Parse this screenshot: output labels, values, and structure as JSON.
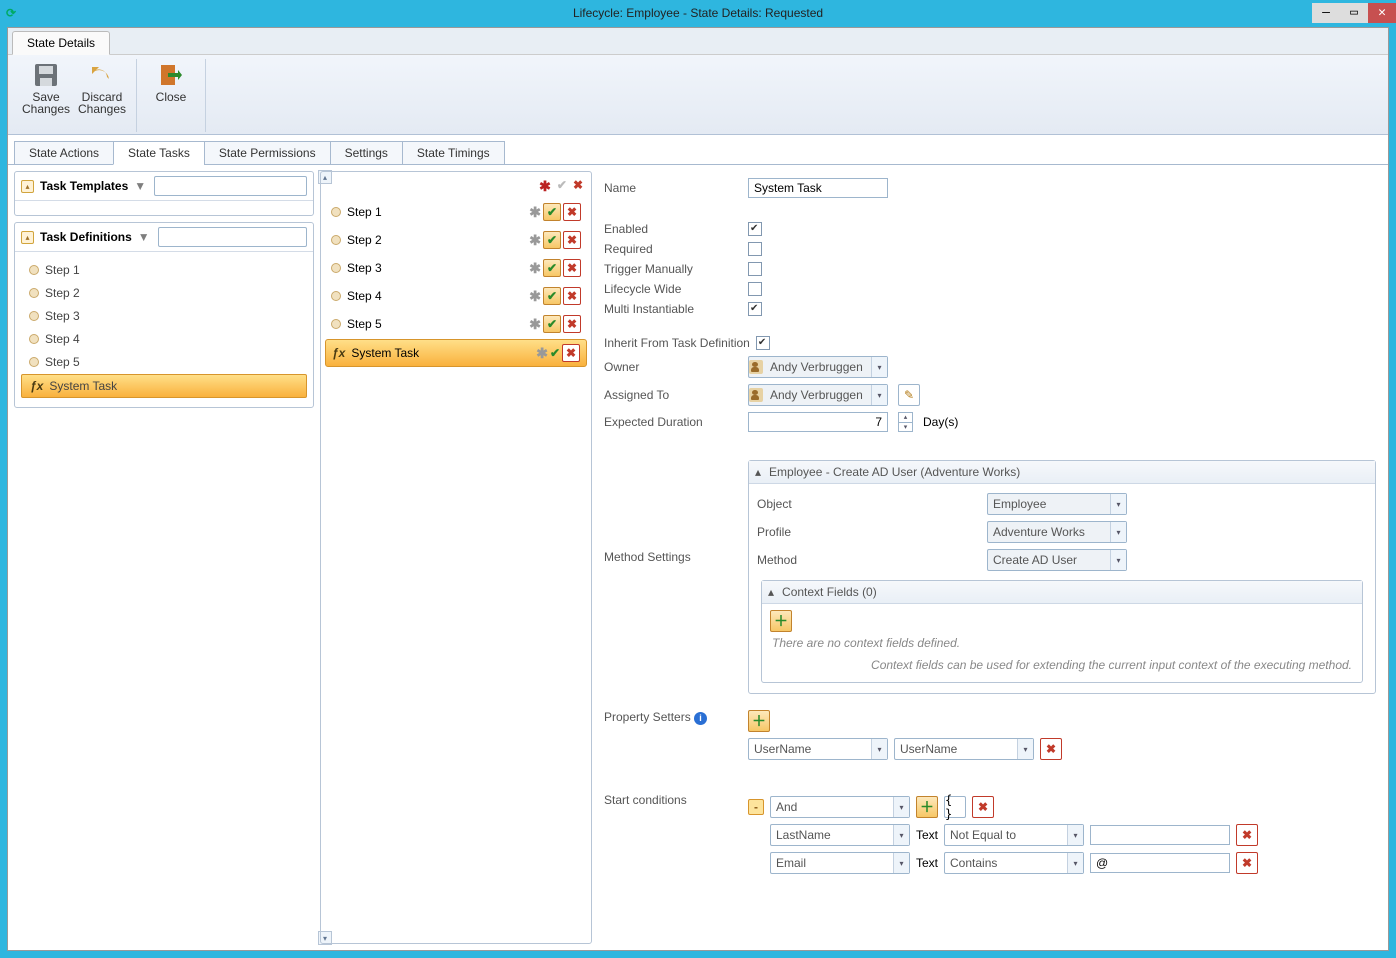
{
  "titlebar": {
    "title": "Lifecycle: Employee - State Details: Requested"
  },
  "ribbon": {
    "tab": "State Details",
    "buttons": {
      "save": "Save\nChanges",
      "discard": "Discard\nChanges",
      "close": "Close"
    }
  },
  "tabs": {
    "actions": "State Actions",
    "tasks": "State Tasks",
    "permissions": "State Permissions",
    "settings": "Settings",
    "timings": "State Timings"
  },
  "left": {
    "templates_label": "Task Templates",
    "definitions_label": "Task Definitions",
    "definitions": [
      "Step 1",
      "Step 2",
      "Step 3",
      "Step 4",
      "Step 5",
      "System Task"
    ]
  },
  "mid": {
    "items": [
      "Step 1",
      "Step 2",
      "Step 3",
      "Step 4",
      "Step 5",
      "System Task"
    ]
  },
  "form": {
    "name_label": "Name",
    "name_value": "System Task",
    "enabled_label": "Enabled",
    "required_label": "Required",
    "trigger_label": "Trigger Manually",
    "lifecycle_label": "Lifecycle Wide",
    "multi_label": "Multi Instantiable",
    "inherit_label": "Inherit From Task Definition",
    "owner_label": "Owner",
    "owner_value": "Andy Verbruggen",
    "assigned_label": "Assigned To",
    "assigned_value": "Andy Verbruggen",
    "duration_label": "Expected Duration",
    "duration_value": "7",
    "duration_unit": "Day(s)",
    "method_settings_label": "Method Settings",
    "method_group_title": "Employee   - Create AD User   (Adventure Works)",
    "object_label": "Object",
    "object_value": "Employee",
    "profile_label": "Profile",
    "profile_value": "Adventure Works",
    "method_label": "Method",
    "method_value": "Create AD User",
    "context_header": "Context Fields  (0)",
    "context_hint1": "There are no context fields defined.",
    "context_hint2": "Context fields can be used for extending the current input context of the executing method.",
    "prop_setters_label": "Property Setters",
    "prop_left": "UserName",
    "prop_right": "UserName",
    "start_label": "Start conditions",
    "start_op": "And",
    "cond1_field": "LastName",
    "cond1_type": "Text",
    "cond1_op": "Not Equal to",
    "cond1_val": "",
    "cond2_field": "Email",
    "cond2_type": "Text",
    "cond2_op": "Contains",
    "cond2_val": "@"
  }
}
